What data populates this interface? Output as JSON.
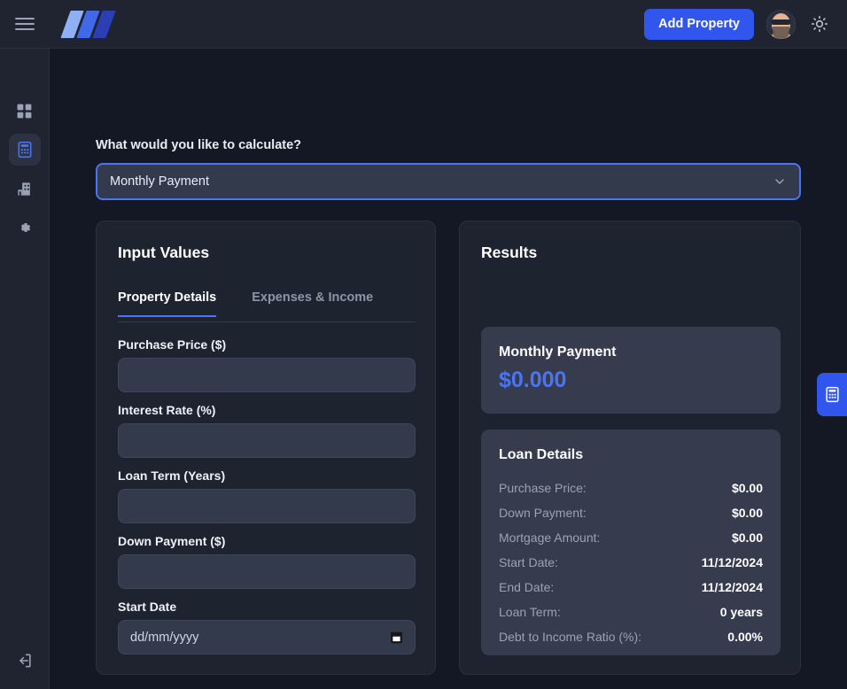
{
  "topbar": {
    "menu_icon": "hamburger-icon",
    "logo_alt": "brand-logo",
    "add_property_label": "Add Property",
    "avatar_alt": "user-avatar",
    "theme_icon": "sun-icon"
  },
  "sidebar": {
    "items": [
      {
        "icon": "grid-dashboard-icon",
        "active": false
      },
      {
        "icon": "calculator-icon",
        "active": true
      },
      {
        "icon": "building-icon",
        "active": false
      },
      {
        "icon": "gear-icon",
        "active": false
      }
    ],
    "logout_icon": "logout-icon"
  },
  "main": {
    "calc_question": "What would you like to calculate?",
    "calc_selected": "Monthly Payment",
    "calc_chevron": "chevron-down-icon",
    "inputs": {
      "title": "Input Values",
      "tabs": [
        {
          "label": "Property Details",
          "active": true
        },
        {
          "label": "Expenses & Income",
          "active": false
        }
      ],
      "fields": [
        {
          "label": "Purchase Price ($)",
          "value": "",
          "placeholder": ""
        },
        {
          "label": "Interest Rate (%)",
          "value": "",
          "placeholder": ""
        },
        {
          "label": "Loan Term (Years)",
          "value": "",
          "placeholder": ""
        },
        {
          "label": "Down Payment ($)",
          "value": "",
          "placeholder": ""
        },
        {
          "label": "Start Date",
          "value": "",
          "placeholder": "dd/mm/yyyy",
          "icon": "calendar-icon"
        }
      ]
    },
    "results": {
      "title": "Results",
      "monthly_label": "Monthly Payment",
      "monthly_value": "$0.000",
      "loan_title": "Loan Details",
      "loan_rows": [
        {
          "key": "Purchase Price:",
          "value": "$0.00"
        },
        {
          "key": "Down Payment:",
          "value": "$0.00"
        },
        {
          "key": "Mortgage Amount:",
          "value": "$0.00"
        },
        {
          "key": "Start Date:",
          "value": "11/12/2024"
        },
        {
          "key": "End Date:",
          "value": "11/12/2024"
        },
        {
          "key": "Loan Term:",
          "value": "0 years"
        },
        {
          "key": "Debt to Income Ratio (%):",
          "value": "0.00%"
        }
      ]
    }
  },
  "float_button": {
    "icon": "calculator-icon"
  },
  "colors": {
    "accent": "#3056ed",
    "accent_light": "#4a74f5",
    "page_bg": "#141824",
    "panel_bg": "#1f2430",
    "card_bg": "#1e2330",
    "inner_bg": "#363c4d",
    "input_bg": "#333a4c"
  }
}
